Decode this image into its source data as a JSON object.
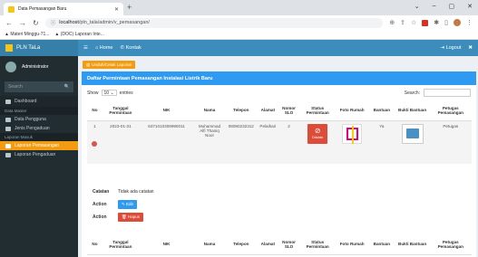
{
  "browser": {
    "tab_title": "Data Pemasangan Baru",
    "url_host": "localhost",
    "url_path": "/pln_tala/admin/v_pemasangan/",
    "bookmarks": [
      "Materi Minggu-71...",
      "(DOC) Laporan Inte..."
    ]
  },
  "app": {
    "brand": "PLN TaLa",
    "user": "Administrator",
    "search_placeholder": "Search",
    "menu": {
      "dashboard": "Dashboard",
      "header_master": "Data Master",
      "data_pengguna": "Data Pengguna",
      "jenis_pengaduan": "Jenis Pengaduan",
      "header_laporan": "Laporan Masuk",
      "laporan_pemasangan": "Laporan Pemasangan",
      "laporan_pengaduan": "Laporan Pengaduan"
    },
    "topnav": {
      "home": "Home",
      "kontak": "Kontak",
      "logout": "Logout"
    }
  },
  "page": {
    "print_button": "Unduh/Cetak Laporan",
    "panel_title": "Daftar Permintaan Pemasangan Instalasi Listrik Baru",
    "show_label": "Show",
    "show_value": "10",
    "entries_label": "entries",
    "search_label": "Search:",
    "columns": [
      "No",
      "Tanggal Permintaan",
      "NIK",
      "Nama",
      "Telepon",
      "Alamat",
      "Nomor SLO",
      "Status Permintaan",
      "Foto Rumah",
      "Bantuan",
      "Bukti Bantuan",
      "Petugas Pemasangan"
    ],
    "row": {
      "no": "1",
      "tanggal": "2023-01-31",
      "nik": "6371010309990011",
      "nama": "Muhammad Alfi Thaniq Noor",
      "telepon": "08080232312",
      "alamat": "Pelaihari",
      "slo": "2",
      "status": "Ditolak",
      "bantuan": "Ya",
      "petugas": "Petugas"
    },
    "catatan_label": "Catatan",
    "catatan_value": "Tidak ada catatan",
    "action_label": "Action",
    "edit_label": "Edit",
    "hapus_label": "Hapus"
  }
}
